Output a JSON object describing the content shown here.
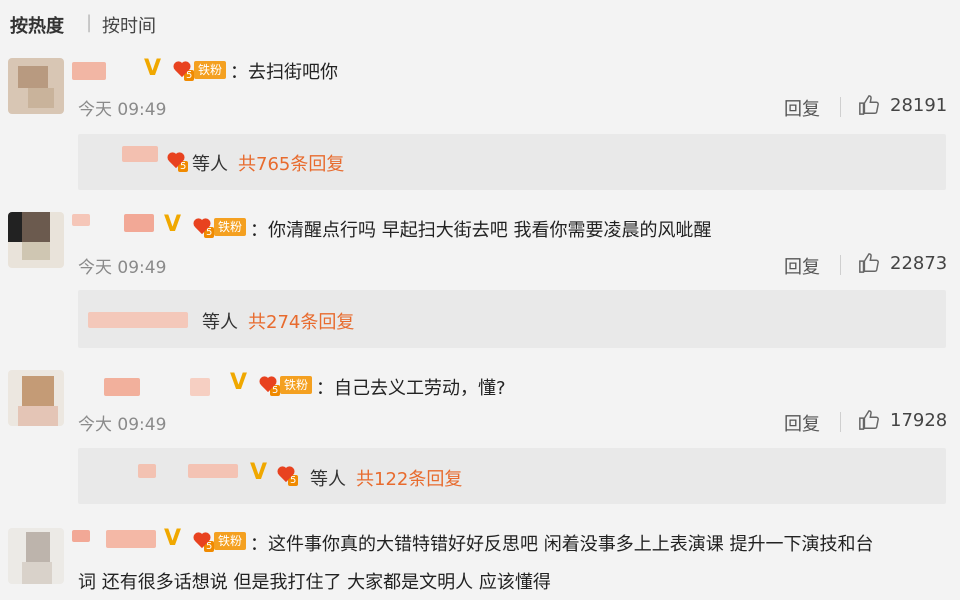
{
  "sort_tabs": {
    "hot": "按热度",
    "separator": "|",
    "time": "按时间"
  },
  "fan_badge_label": "铁粉",
  "fan_badge_level": "5",
  "v_badge": "V",
  "comments": [
    {
      "text": "：去扫街吧你",
      "time": "今天 09:49",
      "reply_label": "回复",
      "likes": "28191",
      "sub": {
        "people": "等人",
        "total": "共765条回复"
      }
    },
    {
      "text": "：你清醒点行吗 早起扫大街去吧 我看你需要凌晨的风呲醒",
      "time": "今天 09:49",
      "reply_label": "回复",
      "likes": "22873",
      "sub": {
        "people": "等人",
        "total": "共274条回复"
      }
    },
    {
      "text": "：自己去义工劳动，懂?",
      "time": "今大 09:49",
      "reply_label": "回复",
      "likes": "17928",
      "sub": {
        "people": "等人",
        "total": "共122条回复"
      }
    },
    {
      "text": "：这件事你真的大错特错好好反思吧 闲着没事多上上表演课 提升一下演技和台",
      "text_line2": "词 还有很多话想说 但是我打住了 大家都是文明人 应该懂得"
    }
  ]
}
